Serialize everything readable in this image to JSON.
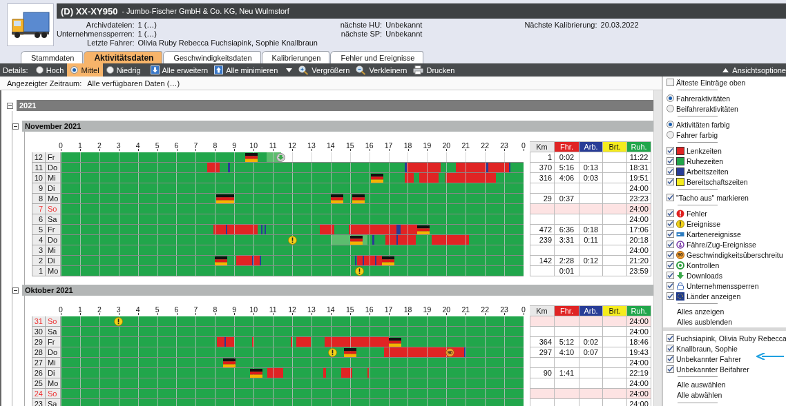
{
  "vehicle": {
    "plate": "(D) XX-XY950",
    "company": "- Jumbo-Fischer GmbH & Co. KG, Neu Wulmstorf"
  },
  "info_columns": [
    [
      {
        "label": "Archivdateien:",
        "value": "1 (…)"
      },
      {
        "label": "Unternehmenssperren:",
        "value": "1 (…)"
      },
      {
        "label": "Letzte Fahrer:",
        "value": "Olivia Ruby Rebecca Fuchsiapink, Sophie Knallbraun"
      }
    ],
    [
      {
        "label": "nächste HU:",
        "value": "Unbekannt"
      },
      {
        "label": "nächste SP:",
        "value": "Unbekannt"
      }
    ],
    [
      {
        "label": "Nächste Kalibrierung:",
        "value": "20.03.2022"
      }
    ]
  ],
  "tabs": [
    {
      "label": "Stammdaten",
      "selected": false
    },
    {
      "label": "Aktivitätsdaten",
      "selected": true
    },
    {
      "label": "Geschwindigkeitsdaten",
      "selected": false
    },
    {
      "label": "Kalibrierungen",
      "selected": false
    },
    {
      "label": "Fehler und Ereignisse",
      "selected": false
    }
  ],
  "toolbar": {
    "details_label": "Details:",
    "detail_options": [
      {
        "label": "Hoch",
        "selected": false
      },
      {
        "label": "Mittel",
        "selected": true
      },
      {
        "label": "Niedrig",
        "selected": false
      }
    ],
    "actions": [
      {
        "kind": "expand",
        "label": "Alle erweitern"
      },
      {
        "kind": "collapse",
        "label": "Alle minimieren"
      },
      {
        "kind": "menu"
      },
      {
        "kind": "zoom_in",
        "label": "Vergrößern"
      },
      {
        "kind": "zoom_out",
        "label": "Verkleinern"
      },
      {
        "kind": "print",
        "label": "Drucken"
      }
    ],
    "view_options": "Ansichtsoptione"
  },
  "period": {
    "label": "Angezeigter Zeitraum:",
    "value": "Alle verfügbaren Daten (…)"
  },
  "year": {
    "title": "2021",
    "expanded": true,
    "months": [
      {
        "title": "November 2021",
        "expanded": true,
        "hours": [
          "0",
          "1",
          "2",
          "3",
          "4",
          "5",
          "6",
          "7",
          "8",
          "9",
          "10",
          "11",
          "12",
          "13",
          "14",
          "15",
          "16",
          "17",
          "18",
          "19",
          "20",
          "21",
          "22",
          "23",
          "0"
        ],
        "columns": [
          {
            "kind": "km",
            "label": "Km"
          },
          {
            "kind": "drive",
            "label": "Fhr."
          },
          {
            "kind": "work",
            "label": "Arb."
          },
          {
            "kind": "standby",
            "label": "Brt."
          },
          {
            "kind": "rest",
            "label": "Ruh."
          }
        ],
        "days": [
          {
            "num": "12",
            "name": "Fr",
            "sunday": false,
            "values": {
              "km": "1",
              "drive": "0:02",
              "rest": "11:22"
            }
          },
          {
            "num": "11",
            "name": "Do",
            "sunday": false,
            "values": {
              "km": "370",
              "drive": "5:16",
              "work": "0:13",
              "rest": "18:31"
            }
          },
          {
            "num": "10",
            "name": "Mi",
            "sunday": false,
            "values": {
              "km": "316",
              "drive": "4:06",
              "work": "0:03",
              "rest": "19:51"
            }
          },
          {
            "num": "9",
            "name": "Di",
            "sunday": false,
            "values": {
              "rest": "24:00"
            }
          },
          {
            "num": "8",
            "name": "Mo",
            "sunday": false,
            "values": {
              "km": "29",
              "drive": "0:37",
              "rest": "23:23"
            }
          },
          {
            "num": "7",
            "name": "So",
            "sunday": true,
            "values": {
              "rest": "24:00"
            }
          },
          {
            "num": "6",
            "name": "Sa",
            "sunday": false,
            "values": {
              "rest": "24:00"
            }
          },
          {
            "num": "5",
            "name": "Fr",
            "sunday": false,
            "values": {
              "km": "472",
              "drive": "6:36",
              "work": "0:18",
              "rest": "17:06"
            }
          },
          {
            "num": "4",
            "name": "Do",
            "sunday": false,
            "values": {
              "km": "239",
              "drive": "3:31",
              "work": "0:11",
              "rest": "20:18"
            }
          },
          {
            "num": "3",
            "name": "Mi",
            "sunday": false,
            "values": {
              "rest": "24:00"
            }
          },
          {
            "num": "2",
            "name": "Di",
            "sunday": false,
            "values": {
              "km": "142",
              "drive": "2:28",
              "work": "0:12",
              "rest": "21:20"
            }
          },
          {
            "num": "1",
            "name": "Mo",
            "sunday": false,
            "values": {
              "drive": "0:01",
              "rest": "23:59"
            }
          }
        ]
      },
      {
        "title": "Oktober 2021",
        "expanded": true,
        "hours": [
          "0",
          "1",
          "2",
          "3",
          "4",
          "5",
          "6",
          "7",
          "8",
          "9",
          "10",
          "11",
          "12",
          "13",
          "14",
          "15",
          "16",
          "17",
          "18",
          "19",
          "20",
          "21",
          "22",
          "23",
          "0"
        ],
        "columns": [
          {
            "kind": "km",
            "label": "Km"
          },
          {
            "kind": "drive",
            "label": "Fhr."
          },
          {
            "kind": "work",
            "label": "Arb."
          },
          {
            "kind": "standby",
            "label": "Brt."
          },
          {
            "kind": "rest",
            "label": "Ruh."
          }
        ],
        "days": [
          {
            "num": "31",
            "name": "So",
            "sunday": true,
            "values": {
              "rest": "24:00"
            }
          },
          {
            "num": "30",
            "name": "Sa",
            "sunday": false,
            "values": {
              "rest": "24:00"
            }
          },
          {
            "num": "29",
            "name": "Fr",
            "sunday": false,
            "values": {
              "km": "364",
              "drive": "5:12",
              "work": "0:02",
              "rest": "18:46"
            }
          },
          {
            "num": "28",
            "name": "Do",
            "sunday": false,
            "speed_badge": "90",
            "values": {
              "km": "297",
              "drive": "4:10",
              "work": "0:07",
              "rest": "19:43"
            }
          },
          {
            "num": "27",
            "name": "Mi",
            "sunday": false,
            "values": {
              "rest": "24:00"
            }
          },
          {
            "num": "26",
            "name": "Di",
            "sunday": false,
            "values": {
              "km": "90",
              "drive": "1:41",
              "rest": "22:19"
            }
          },
          {
            "num": "25",
            "name": "Mo",
            "sunday": false,
            "values": {
              "rest": "24:00"
            }
          },
          {
            "num": "24",
            "name": "So",
            "sunday": true,
            "values": {
              "rest": "24:00"
            }
          },
          {
            "num": "23",
            "name": "Sa",
            "sunday": false,
            "values": {
              "rest": "24:00"
            }
          }
        ]
      }
    ]
  },
  "options": {
    "groups": [
      [
        {
          "kind": "checkbox",
          "label": "Älteste Einträge oben",
          "checked": false
        }
      ],
      [
        {
          "kind": "radio",
          "label": "Fahreraktivitäten",
          "selected": true
        },
        {
          "kind": "radio",
          "label": "Beifahreraktivitäten",
          "selected": false
        }
      ],
      [
        {
          "kind": "radio",
          "label": "Aktivitäten farbig",
          "selected": true
        },
        {
          "kind": "radio",
          "label": "Fahrer farbig",
          "selected": false
        }
      ],
      [
        {
          "kind": "swatch",
          "label": "Lenkzeiten",
          "checked": true,
          "color": "#e02424"
        },
        {
          "kind": "swatch",
          "label": "Ruhezeiten",
          "checked": true,
          "color": "#21a64b"
        },
        {
          "kind": "swatch",
          "label": "Arbeitszeiten",
          "checked": true,
          "color": "#283c96"
        },
        {
          "kind": "swatch",
          "label": "Bereitschaftszeiten",
          "checked": true,
          "color": "#f5ec1e"
        }
      ],
      [
        {
          "kind": "checkbox",
          "label": "\"Tacho aus\" markieren",
          "checked": true
        }
      ],
      [
        {
          "kind": "error",
          "label": "Fehler",
          "checked": true
        },
        {
          "kind": "event",
          "label": "Ereignisse",
          "checked": true
        },
        {
          "kind": "card",
          "label": "Kartenereignisse",
          "checked": true
        },
        {
          "kind": "ferry",
          "label": "Fähre/Zug-Ereignisse",
          "checked": true
        },
        {
          "kind": "speed",
          "icon_text": "90",
          "label": "Geschwindigkeitsüberschreitu",
          "checked": true
        },
        {
          "kind": "control",
          "label": "Kontrollen",
          "checked": true
        },
        {
          "kind": "download",
          "label": "Downloads",
          "checked": true
        },
        {
          "kind": "lock",
          "label": "Unternehmenssperren",
          "checked": true
        },
        {
          "kind": "country",
          "label": "Länder anzeigen",
          "checked": true
        }
      ],
      [
        {
          "kind": "link",
          "label": "Alles anzeigen"
        },
        {
          "kind": "link",
          "label": "Alles ausblenden"
        }
      ]
    ],
    "drivers": [
      {
        "label": "Fuchsiapink, Olivia Ruby Rebecca",
        "checked": true
      },
      {
        "label": "Knallbraun, Sophie",
        "checked": true
      },
      {
        "label": "Unbekannter Fahrer",
        "checked": true
      },
      {
        "label": "Unbekannter Beifahrer",
        "checked": true
      }
    ],
    "driver_links": [
      "Alle auswählen",
      "Alle abwählen"
    ]
  }
}
